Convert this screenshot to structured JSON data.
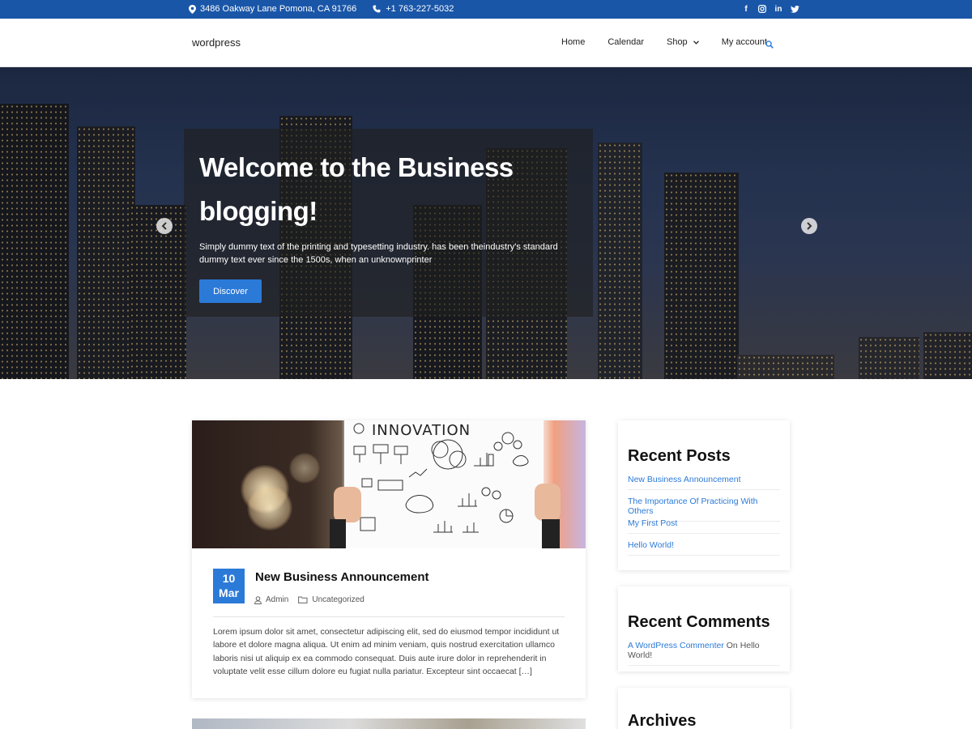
{
  "topbar": {
    "address": "3486 Oakway Lane Pomona, CA 91766",
    "phone": "+1 763-227-5032",
    "social": [
      "facebook-icon",
      "instagram-icon",
      "linkedin-icon",
      "twitter-icon"
    ],
    "bg_color": "#1a56a8"
  },
  "header": {
    "brand": "wordpress",
    "nav": [
      "Home",
      "Calendar",
      "Shop",
      "My account"
    ]
  },
  "hero": {
    "title": "Welcome to the Business blogging!",
    "subtitle": "Simply dummy text of the printing and typesetting industry. has been theindustry's standard dummy text ever since the 1500s, when an unknownprinter",
    "button": "Discover"
  },
  "post": {
    "image_caption": "INNOVATION",
    "date_day": "10",
    "date_month": "Mar",
    "title": "New Business Announcement",
    "author": "Admin",
    "category": "Uncategorized",
    "excerpt": "Lorem ipsum dolor sit amet, consectetur adipiscing elit, sed do eiusmod tempor incididunt ut labore et dolore magna aliqua. Ut enim ad minim veniam, quis nostrud exercitation ullamco laboris nisi ut aliquip ex ea commodo consequat. Duis aute irure dolor in reprehenderit in voluptate velit esse cillum dolore eu fugiat nulla pariatur. Excepteur sint occaecat […]"
  },
  "sidebar": {
    "recent_posts": {
      "title": "Recent Posts",
      "items": [
        "New Business Announcement",
        "The Importance Of Practicing With Others",
        "My First Post",
        "Hello World!"
      ]
    },
    "recent_comments": {
      "title": "Recent Comments",
      "commenter": "A WordPress Commenter",
      "on_text": " On ",
      "post": "Hello World!"
    },
    "archives": {
      "title": "Archives"
    }
  },
  "colors": {
    "accent": "#2b7ad8"
  }
}
